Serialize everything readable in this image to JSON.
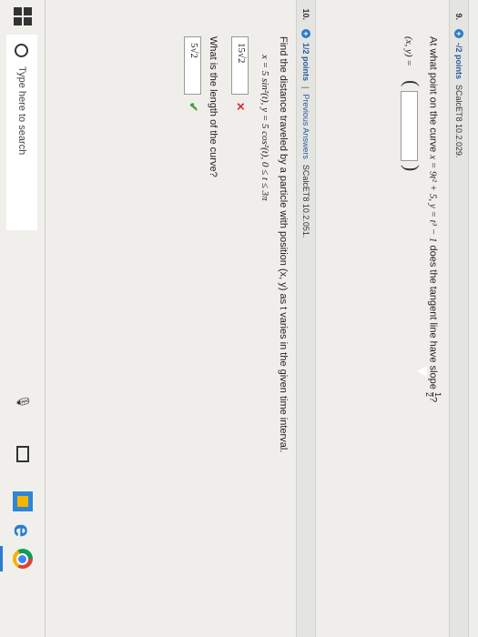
{
  "q9": {
    "number": "9.",
    "plus": "+",
    "points": "-/2 points",
    "source": "SCalcET8 10.2.029.",
    "prompt_start": "At what point on the curve ",
    "curve": "x = 9t² + 5,   y = t³ − 1",
    "prompt_end": " does the tangent line have slope ",
    "slope_num": "1",
    "slope_den": "2",
    "qmark": "?",
    "answer_label": "(x, y) =",
    "open_paren": "(",
    "close_paren": ")",
    "answer_value": ""
  },
  "q10": {
    "number": "10.",
    "plus": "+",
    "points": "1/2 points",
    "separator": "|",
    "previous": "Previous Answers",
    "source": "SCalcET8 10.2.051.",
    "prompt": "Find the distance traveled by a particle with position (x, y) as t varies in the given time interval.",
    "equations": "x = 5 sin²(t),    y = 5 cos²(t),    0 ≤ t ≤ 3π",
    "answer1": "15√2",
    "answer1_status": "✕",
    "prompt2": "What is the length of the curve?",
    "answer2": "5√2",
    "answer2_status": "✔"
  },
  "taskbar": {
    "search_placeholder": "Type here to search",
    "mic": "🎙",
    "edge": "e"
  }
}
